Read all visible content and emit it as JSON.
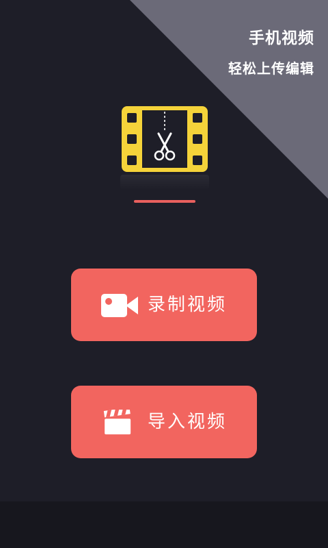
{
  "header": {
    "slogan_line1": "手机视频",
    "slogan_line2": "轻松上传编辑"
  },
  "logo": {
    "icon": "film-scissors-icon",
    "frame_color": "#f5d33a"
  },
  "actions": [
    {
      "label": "录制视频",
      "icon": "video-camera-icon"
    },
    {
      "label": "导入视频",
      "icon": "clapperboard-icon"
    }
  ],
  "colors": {
    "background": "#1e1e28",
    "corner": "#6b6a78",
    "accent": "#f2655f"
  }
}
